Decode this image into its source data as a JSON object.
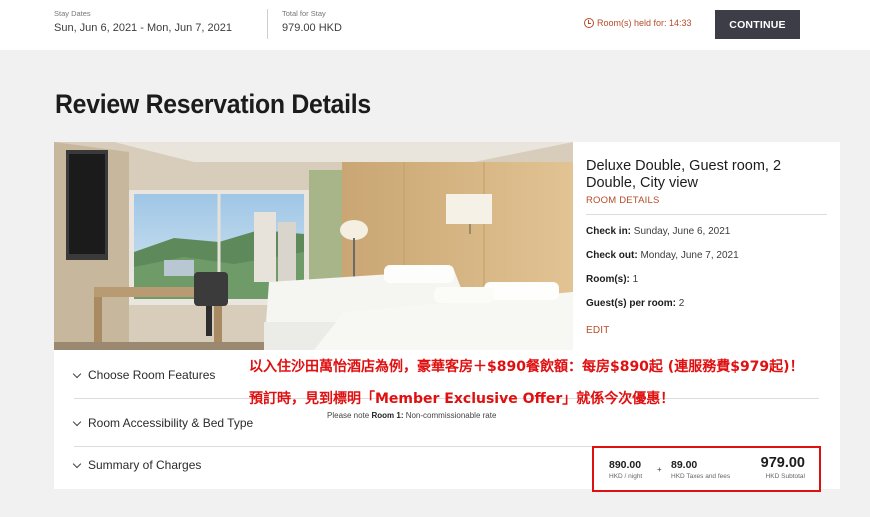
{
  "topbar": {
    "stay_dates_label": "Stay Dates",
    "stay_dates_value": "Sun, Jun 6, 2021 - Mon, Jun 7, 2021",
    "total_label": "Total for Stay",
    "total_value": "979.00 HKD",
    "held_text": "Room(s) held for: 14:33",
    "continue_label": "CONTINUE"
  },
  "page_title": "Review Reservation Details",
  "room": {
    "name": "Deluxe Double, Guest room, 2 Double, City view",
    "details_link": "ROOM DETAILS",
    "checkin_label": "Check in:",
    "checkin_value": " Sunday, June 6, 2021",
    "checkout_label": "Check out:",
    "checkout_value": " Monday, June 7, 2021",
    "rooms_label": "Room(s):",
    "rooms_value": " 1",
    "guests_label": "Guest(s) per room:",
    "guests_value": " 2",
    "edit_link": "EDIT"
  },
  "accordion": {
    "features": "Choose Room Features",
    "accessibility": "Room Accessibility & Bed Type",
    "charges": "Summary of Charges"
  },
  "note": {
    "prefix": "Please note ",
    "room_label": "Room 1:",
    "text": " Non-commissionable rate"
  },
  "charges": {
    "nightly_value": "890.00",
    "nightly_label": "HKD / night",
    "plus": "+",
    "taxes_value": "89.00",
    "taxes_label": "HKD Taxes and fees",
    "subtotal_value": "979.00",
    "subtotal_label": "HKD Subtotal"
  },
  "annotations": {
    "line1": "以入住沙田萬怡酒店為例，豪華客房＋$890餐飲額：每房$890起 (連服務費$979起)！",
    "line2": "預訂時，見到標明「Member Exclusive Offer」就係今次優惠！"
  },
  "colors": {
    "accent": "#b74b27",
    "button": "#3d3d48",
    "annotation": "#e01010"
  }
}
